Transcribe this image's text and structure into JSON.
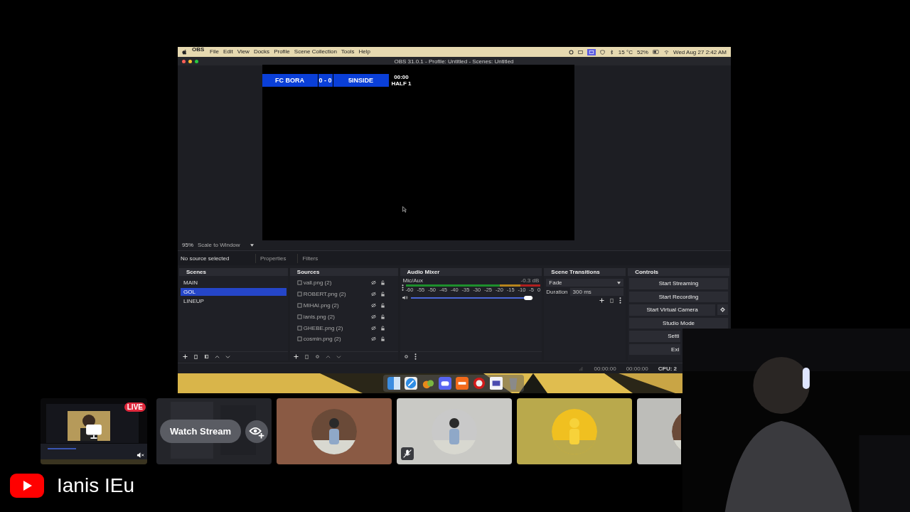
{
  "obs": {
    "menu_bar": {
      "app": "OBS",
      "items": [
        "File",
        "Edit",
        "View",
        "Docks",
        "Profile",
        "Scene Collection",
        "Tools",
        "Help"
      ],
      "temperature": "15 °C",
      "battery": "52%",
      "clock": "Wed Aug 27  2:42 AM"
    },
    "title": "OBS 31.0.1 - Profile: Untitled - Scenes: Untitled",
    "scoreboard": {
      "home": "FC BORA",
      "score": "0 - 0",
      "away": "5INSIDE",
      "clock": "00:00",
      "period": "HALF 1"
    },
    "zoom": "95%",
    "scale_mode": "Scale to Window",
    "source_status": "No source selected",
    "properties": "Properties",
    "filters": "Filters",
    "scenes": {
      "title": "Scenes",
      "items": [
        {
          "label": "MAIN",
          "selected": false
        },
        {
          "label": "GOL",
          "selected": true
        },
        {
          "label": "LINEUP",
          "selected": false
        }
      ]
    },
    "sources": {
      "title": "Sources",
      "items": [
        "vall.png (2)",
        "ROBERT.png (2)",
        "MIHAI.png (2)",
        "ianis.png (2)",
        "GHEBE.png (2)",
        "cosmin.png (2)"
      ]
    },
    "audio_mixer": {
      "title": "Audio Mixer",
      "channel": "Mic/Aux",
      "reading": "-0.3 dB",
      "ticks": [
        "-60",
        "-55",
        "-50",
        "-45",
        "-40",
        "-35",
        "-30",
        "-25",
        "-20",
        "-15",
        "-10",
        "-5",
        "0"
      ],
      "level": 0.96
    },
    "transitions": {
      "title": "Scene Transitions",
      "transition": "Fade",
      "duration_label": "Duration",
      "duration": "300 ms"
    },
    "controls": {
      "title": "Controls",
      "buttons": [
        "Start Streaming",
        "Start Recording",
        "Start Virtual Camera",
        "Studio Mode",
        "Setti",
        "Exi"
      ]
    },
    "status_bar": {
      "stream_time": "00:00:00",
      "record_time": "00:00:00",
      "cpu": "CPU: 2"
    }
  },
  "call": {
    "tiles": [
      {
        "kind": "stream",
        "badge": "LIVE"
      },
      {
        "kind": "watch",
        "button": "Watch Stream"
      },
      {
        "kind": "avatar",
        "color": "#8a5a44",
        "muted": false
      },
      {
        "kind": "avatar",
        "color": "#c9c9c5",
        "muted": true
      },
      {
        "kind": "avatar",
        "color": "#b9a94c",
        "muted": false
      },
      {
        "kind": "avatar",
        "color": "#bdbdb9",
        "muted": false
      }
    ]
  },
  "channel_name": "Ianis IEu"
}
